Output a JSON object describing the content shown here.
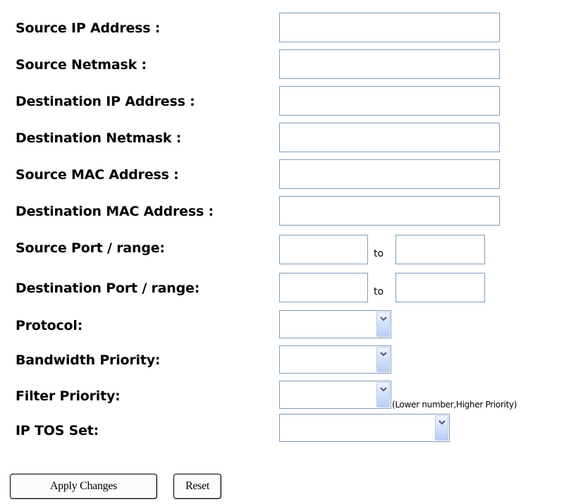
{
  "fields": {
    "source_ip_label": "Source IP Address :",
    "source_netmask_label": "Source Netmask :",
    "dest_ip_label": "Destination IP Address :",
    "dest_netmask_label": "Destination Netmask :",
    "source_mac_label": "Source MAC Address :",
    "dest_mac_label": "Destination MAC Address :",
    "source_port_label": "Source Port / range:",
    "dest_port_label": "Destination Port / range:",
    "protocol_label": "Protocol:",
    "bandwidth_priority_label": "Bandwidth Priority:",
    "filter_priority_label": "Filter Priority:",
    "ip_tos_label": "IP TOS Set:"
  },
  "values": {
    "source_ip": "",
    "source_netmask": "",
    "dest_ip": "",
    "dest_netmask": "",
    "source_mac": "",
    "dest_mac": "",
    "source_port_from": "",
    "source_port_to": "",
    "dest_port_from": "",
    "dest_port_to": "",
    "protocol": "",
    "bandwidth_priority": "",
    "filter_priority": "",
    "ip_tos": ""
  },
  "range_separator": "to",
  "filter_priority_note": "(Lower number,Higher Priority)",
  "buttons": {
    "apply": "Apply Changes",
    "reset": "Reset"
  },
  "colors": {
    "field_border": "#7f9db9",
    "dropdown_arrow": "#4d6185"
  },
  "icons": {
    "dropdown": "chevron-down-icon"
  }
}
